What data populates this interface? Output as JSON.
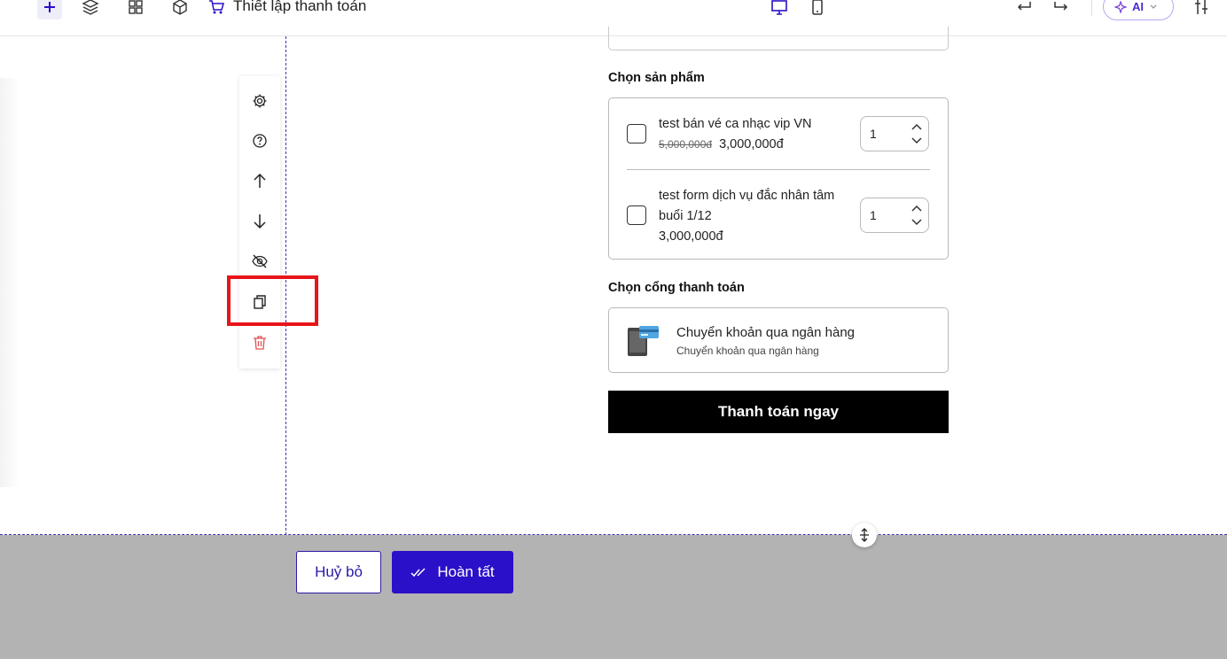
{
  "topbar": {
    "title": "Thiết lập thanh toán",
    "ai_label": "AI",
    "icons": [
      "plus-icon",
      "layers-icon",
      "grid-icon",
      "cube-icon",
      "cart-icon",
      "desktop-icon",
      "mobile-icon",
      "undo-icon",
      "redo-icon",
      "settings-sliders-icon"
    ]
  },
  "side_toolbar": {
    "icons": [
      "gear-icon",
      "help-icon",
      "arrow-up-icon",
      "arrow-down-icon",
      "eye-off-icon",
      "duplicate-icon",
      "trash-icon"
    ]
  },
  "products": {
    "label": "Chọn sản phẩm",
    "items": [
      {
        "name": "test bán vé ca nhạc vip VN",
        "old_price": "5,000,000đ",
        "price": "3,000,000đ",
        "qty": "1"
      },
      {
        "name_line1": "test form dịch vụ đắc nhân tâm",
        "name_line2": "buổi 1/12",
        "price": "3,000,000đ",
        "qty": "1"
      }
    ]
  },
  "gateway": {
    "label": "Chọn cổng thanh toán",
    "title": "Chuyển khoản qua ngân hàng",
    "subtitle": "Chuyển khoản qua ngân hàng"
  },
  "pay_button": "Thanh toán ngay",
  "footer": {
    "cancel_label": "Huỷ bỏ",
    "done_label": "Hoàn tất"
  },
  "colors": {
    "accent": "#2a10c8",
    "highlight": "#e8141a",
    "footer_bg": "#b3b3b3"
  }
}
